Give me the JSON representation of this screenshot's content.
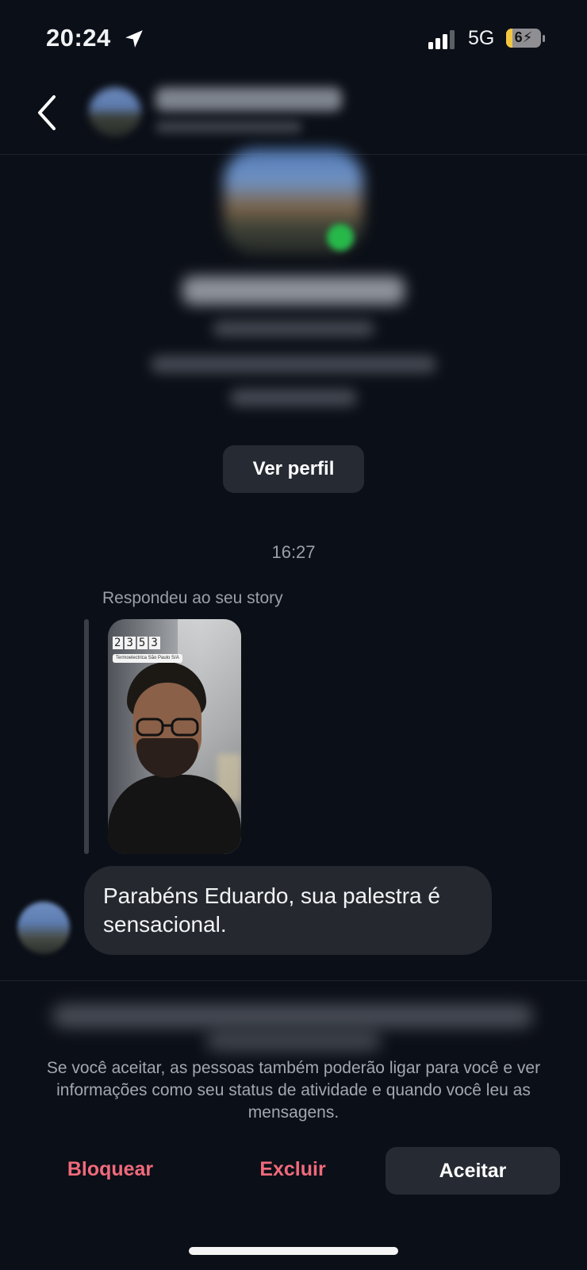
{
  "status_bar": {
    "time": "20:24",
    "network": "5G",
    "battery_level": "6",
    "battery_charging": true,
    "icons": [
      "location-arrow-icon",
      "signal-bars-icon",
      "battery-icon"
    ]
  },
  "header": {
    "back_icon": "chevron-left-icon"
  },
  "profile": {
    "view_profile_label": "Ver perfil"
  },
  "conversation": {
    "timestamp": "16:27",
    "story_reply_label": "Respondeu ao seu story",
    "story_clock_digits": [
      "2",
      "3",
      "5",
      "3"
    ],
    "story_location_tag": "Termoelectrica São Paulo S/A",
    "message_text": "Parabéns Eduardo, sua palestra é sensacional."
  },
  "request_footer": {
    "notice": "Se você aceitar, as pessoas também poderão ligar para você e ver informações como seu status de atividade e quando você leu as mensagens.",
    "block_label": "Bloquear",
    "delete_label": "Excluir",
    "accept_label": "Aceitar"
  },
  "colors": {
    "background": "#0b0f17",
    "bubble": "#25282f",
    "button": "#262a33",
    "danger": "#f06a7b",
    "muted_text": "#9aa0a8"
  }
}
